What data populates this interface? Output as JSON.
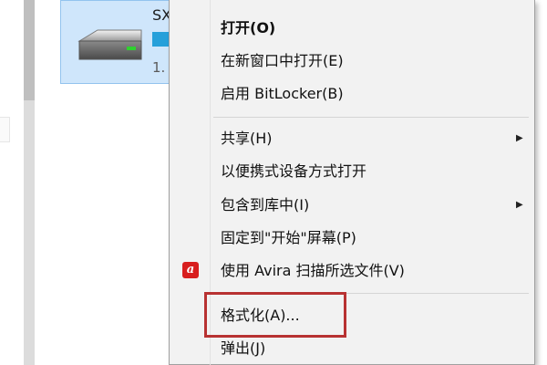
{
  "drive": {
    "name": "SX",
    "size": "1.",
    "usage_fraction": 0.3
  },
  "menu": {
    "open": "打开(O)",
    "open_new_window": "在新窗口中打开(E)",
    "bitlocker": "启用 BitLocker(B)",
    "share": "共享(H)",
    "portable_open": "以便携式设备方式打开",
    "include_library": "包含到库中(I)",
    "pin_start": "固定到\"开始\"屏幕(P)",
    "avira_scan": "使用 Avira 扫描所选文件(V)",
    "format": "格式化(A)...",
    "eject": "弹出(J)"
  },
  "icons": {
    "submenu": "submenu-arrow-icon",
    "avira": "avira-icon",
    "drive": "usb-drive-icon"
  },
  "colors": {
    "highlight": "#b83232",
    "selection": "#cfe6fb",
    "avira": "#d81e1e"
  }
}
